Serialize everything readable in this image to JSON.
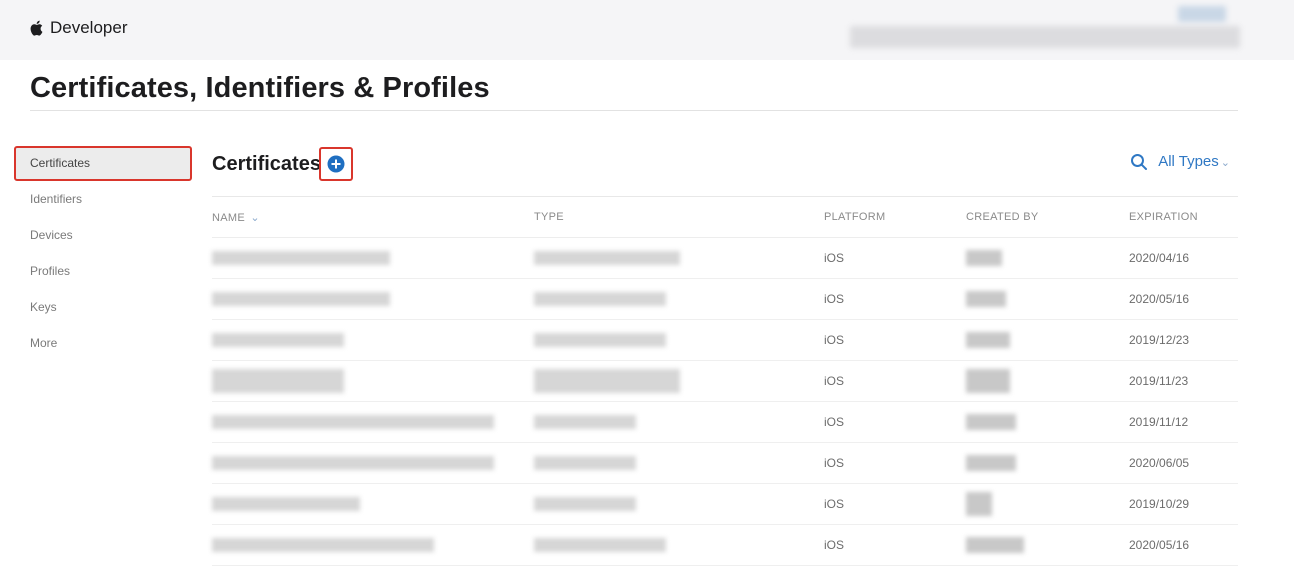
{
  "header": {
    "brand": "Developer",
    "apple_icon": "apple-logo-icon"
  },
  "page_title": "Certificates, Identifiers & Profiles",
  "sidebar": {
    "items": [
      {
        "label": "Certificates",
        "active": true
      },
      {
        "label": "Identifiers",
        "active": false
      },
      {
        "label": "Devices",
        "active": false
      },
      {
        "label": "Profiles",
        "active": false
      },
      {
        "label": "Keys",
        "active": false
      },
      {
        "label": "More",
        "active": false
      }
    ]
  },
  "section": {
    "title": "Certificates",
    "add_icon": "plus-circle-icon",
    "filter_label": "All Types",
    "filter_icon": "search-icon"
  },
  "table": {
    "columns": [
      "NAME",
      "TYPE",
      "PLATFORM",
      "CREATED BY",
      "EXPIRATION"
    ],
    "rows": [
      {
        "platform": "iOS",
        "expiration": "2020/04/16"
      },
      {
        "platform": "iOS",
        "expiration": "2020/05/16"
      },
      {
        "platform": "iOS",
        "expiration": "2019/12/23"
      },
      {
        "platform": "iOS",
        "expiration": "2019/11/23"
      },
      {
        "platform": "iOS",
        "expiration": "2019/11/12"
      },
      {
        "platform": "iOS",
        "expiration": "2020/06/05"
      },
      {
        "platform": "iOS",
        "expiration": "2019/10/29"
      },
      {
        "platform": "iOS",
        "expiration": "2020/05/16"
      }
    ]
  },
  "colors": {
    "accent": "#2f78c4",
    "highlight": "#d9362c",
    "add_button": "#1f6fc1"
  }
}
